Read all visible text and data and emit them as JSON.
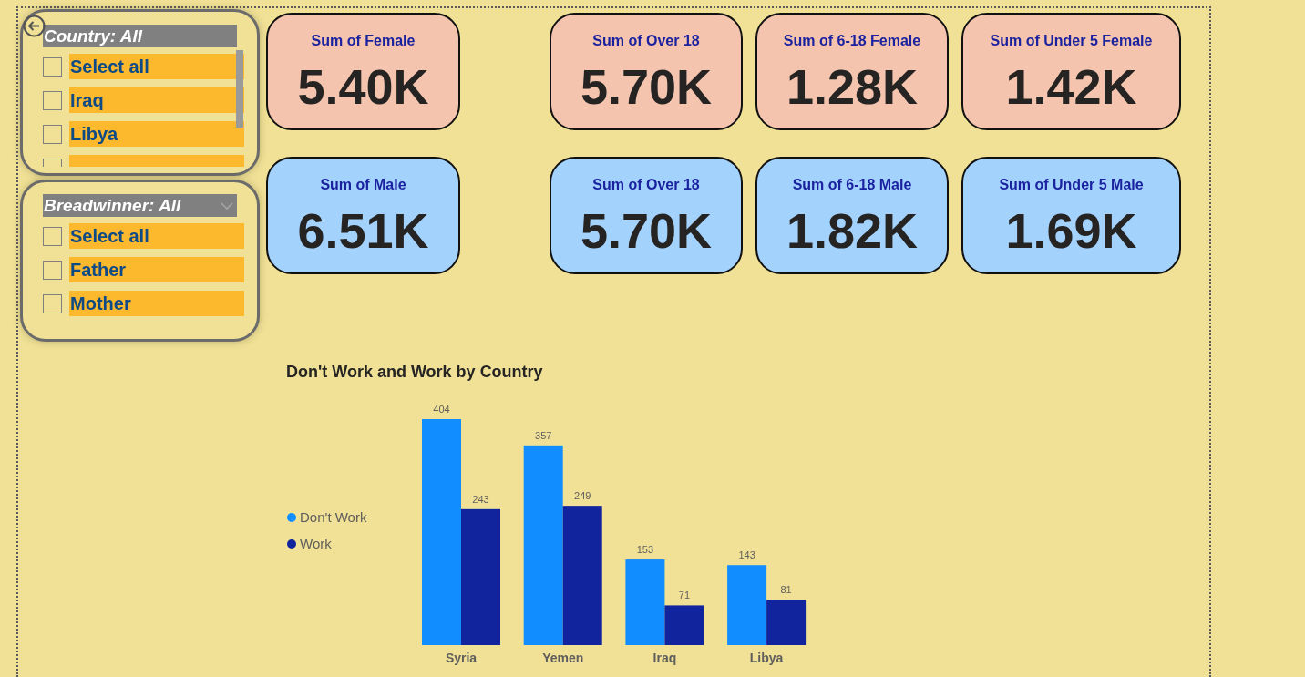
{
  "slicers": [
    {
      "title": "Country: All",
      "has_dropdown": false,
      "scrollable": true,
      "items": [
        {
          "label": "Select all",
          "checked": false
        },
        {
          "label": "Iraq",
          "checked": false
        },
        {
          "label": "Libya",
          "checked": false
        },
        {
          "checked": false
        }
      ]
    },
    {
      "title": "Breadwinner: All",
      "has_dropdown": true,
      "scrollable": false,
      "items": [
        {
          "label": "Select all",
          "checked": false
        },
        {
          "label": "Father",
          "checked": false
        },
        {
          "label": "Mother",
          "checked": false
        }
      ]
    }
  ],
  "kpi_rows": [
    {
      "color": "#f4c4ae",
      "cards": [
        {
          "title": "Sum of Female",
          "value": "5.40K"
        },
        {
          "title": "Sum of Over 18",
          "value": "5.70K"
        },
        {
          "title": "Sum of 6-18 Female",
          "value": "1.28K"
        },
        {
          "title": "Sum of Under 5 Female",
          "value": "1.42K"
        }
      ]
    },
    {
      "color": "#a3d2fd",
      "cards": [
        {
          "title": "Sum of Male",
          "value": "6.51K"
        },
        {
          "title": "Sum of Over 18",
          "value": "5.70K"
        },
        {
          "title": "Sum of 6-18 Male",
          "value": "1.82K"
        },
        {
          "title": "Sum of Under 5 Male",
          "value": "1.69K"
        }
      ]
    }
  ],
  "chart": {
    "chart_data": [
      {
        "type": "bar",
        "title": "Don't Work and Work by Country",
        "categories": [
          "Syria",
          "Yemen",
          "Iraq",
          "Libya"
        ],
        "series": [
          {
            "name": "Don't Work",
            "color": "#118dff",
            "values": [
              404,
              357,
              153,
              143
            ]
          },
          {
            "name": "Work",
            "color": "#12239e",
            "values": [
              243,
              249,
              71,
              81
            ]
          }
        ],
        "data_labels": true,
        "legend": "left"
      }
    ]
  }
}
